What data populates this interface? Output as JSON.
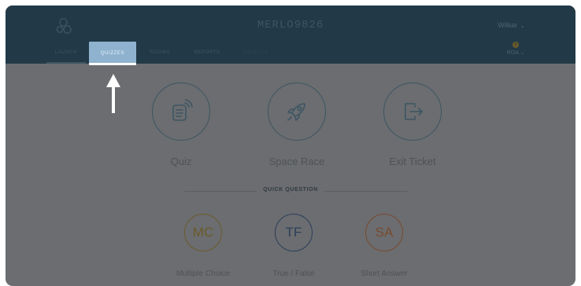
{
  "header": {
    "room_name": "MERLO9826",
    "user_menu_label": "Wilkar",
    "credits_label": "ROA",
    "credits_count": "0"
  },
  "tabs": [
    {
      "label": "LAUNCH"
    },
    {
      "label": "QUIZZES"
    },
    {
      "label": "ROOMS"
    },
    {
      "label": "REPORTS"
    },
    {
      "label": "RESULTS"
    }
  ],
  "activities": [
    {
      "label": "Quiz",
      "icon": "document-icon"
    },
    {
      "label": "Space Race",
      "icon": "rocket-icon"
    },
    {
      "label": "Exit Ticket",
      "icon": "exit-icon"
    }
  ],
  "quick_question": {
    "title": "QUICK QUESTION",
    "items": [
      {
        "abbr": "MC",
        "label": "Multiple Choice",
        "color": "#6b5a2a"
      },
      {
        "abbr": "TF",
        "label": "True / False",
        "color": "#2b3e5a"
      },
      {
        "abbr": "SA",
        "label": "Short Answer",
        "color": "#7a4a2e"
      }
    ]
  },
  "colors": {
    "header_bg": "#223a48",
    "overlay": "#6b6d70",
    "highlight_tab": "#8fb3cf"
  }
}
